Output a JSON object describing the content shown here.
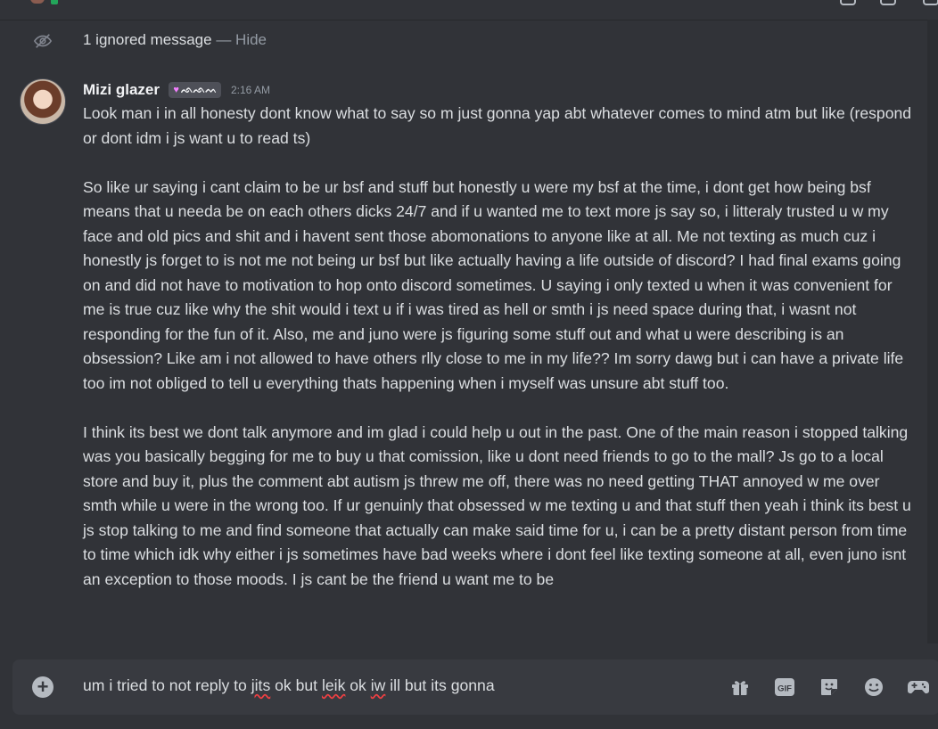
{
  "ignored_notice": {
    "text": "1 ignored message",
    "separator": " — ",
    "hide_label": "Hide",
    "icon": "eye-slash-icon"
  },
  "message": {
    "username": "Mizi glazer",
    "tag": "ᨒᨒᨓ",
    "tag_icon": "heart-icon",
    "timestamp": "2:16 AM",
    "paragraphs": [
      "Look man i in all honesty dont know what to say so m just gonna yap abt whatever comes to mind atm but like (respond or dont idm i js want u to read ts)",
      "So like ur saying i cant claim to be ur bsf and stuff but honestly u were my bsf at the time, i dont get how being bsf means that u needa be on each others dicks 24/7 and if u wanted me to text more js say so, i litteraly trusted u w my face and old pics and shit and i havent sent those abomonations to anyone like at all. Me not texting as much cuz i honestly js forget to is not me not being ur bsf but like actually having a life outside of discord? I had final exams going on and did not have to motivation to hop onto discord sometimes. U saying i only texted u when it was convenient for me is true cuz like why the shit would i text u if i was tired as hell or smth i js need space during that, i wasnt not responding for the fun of it. Also, me and juno were js figuring some stuff out and what u were describing is an obsession? Like am i not allowed to have others rlly close to me in my life?? Im sorry dawg but i can have a private life too im not obliged to tell u everything thats happening when i myself was unsure abt stuff too.",
      "I think its best we dont talk anymore and im glad i could help u out in the past. One of the main reason i stopped talking was you basically begging for me to buy u that comission, like u dont need friends to go to the mall? Js go to a local store and buy it, plus the comment abt autism js threw me off, there was no need getting THAT annoyed w me over smth while u were in the wrong too. If ur genuinly that obsessed w me texting u and that stuff then yeah i think its best u js stop talking to me and find someone that actually can make said time for u, i can be a pretty distant person from time to time which idk why either i js sometimes have bad weeks where i dont feel like texting someone at all, even juno isnt an exception to those moods. I js cant be the friend u want me to be"
    ]
  },
  "composer": {
    "segments": [
      {
        "text": "um i tried to not reply to ",
        "misspelled": false
      },
      {
        "text": "jits",
        "misspelled": true
      },
      {
        "text": " ok but ",
        "misspelled": false
      },
      {
        "text": "leik",
        "misspelled": true
      },
      {
        "text": " ok ",
        "misspelled": false
      },
      {
        "text": "iw",
        "misspelled": true
      },
      {
        "text": " ill but its gonna",
        "misspelled": false
      }
    ],
    "gif_label": "GIF",
    "icons": [
      "add-circle-icon",
      "gift-icon",
      "gif-icon",
      "sticker-icon",
      "emoji-icon",
      "apps-icon"
    ]
  },
  "colors": {
    "background": "#313338",
    "composer_bg": "#383a40",
    "text": "#dbdee1",
    "muted": "#949ba4",
    "tag_bg": "#4e5058",
    "misspell_underline": "#f23f42"
  }
}
